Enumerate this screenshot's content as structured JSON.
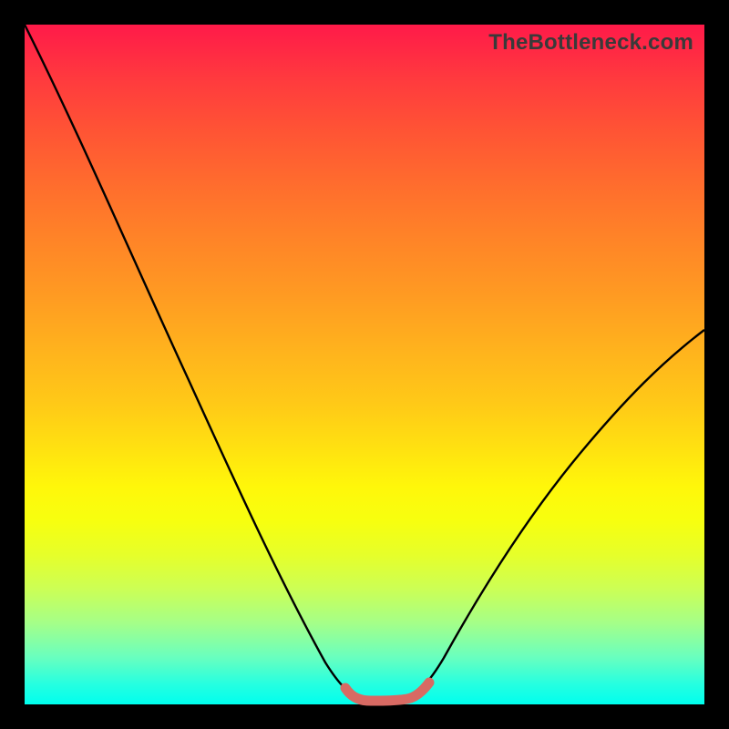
{
  "watermark": "TheBottleneck.com",
  "colors": {
    "frame": "#000000",
    "curve_stroke": "#000000",
    "highlight_stroke": "#d86a63"
  },
  "chart_data": {
    "type": "line",
    "title": "",
    "xlabel": "",
    "ylabel": "",
    "xlim": [
      0,
      100
    ],
    "ylim": [
      0,
      100
    ],
    "series": [
      {
        "name": "bottleneck-curve",
        "x": [
          0,
          4,
          8,
          12,
          16,
          20,
          24,
          28,
          32,
          36,
          40,
          44,
          48,
          50,
          52,
          54,
          56,
          58,
          60,
          64,
          68,
          72,
          76,
          80,
          84,
          88,
          92,
          96,
          100
        ],
        "y": [
          100,
          92,
          84,
          76,
          68,
          59,
          50,
          41,
          32,
          23,
          15,
          8,
          3,
          1,
          0.5,
          0.5,
          1,
          2,
          4,
          9,
          15,
          22,
          29,
          36,
          43,
          50,
          56,
          62,
          67
        ]
      },
      {
        "name": "highlight-band",
        "x": [
          48,
          50,
          52,
          54,
          56,
          58
        ],
        "y": [
          3,
          1,
          0.5,
          0.5,
          1,
          2
        ]
      }
    ]
  }
}
